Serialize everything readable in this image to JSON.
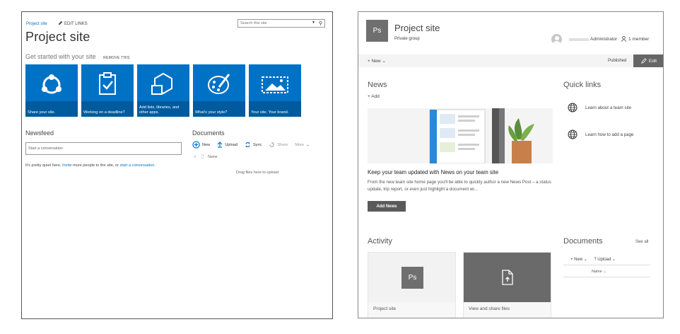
{
  "left": {
    "breadcrumb": "Project site",
    "edit_links": "EDIT LINKS",
    "search_placeholder": "Search this site",
    "title": "Project site",
    "get_started": "Get started with your site",
    "remove_this": "REMOVE THIS",
    "tiles": [
      {
        "label": "Share your site.",
        "icon": "share-icon"
      },
      {
        "label": "Working on a deadline?",
        "icon": "task-clipboard-icon"
      },
      {
        "label": "Add lists, libraries, and other apps.",
        "icon": "apps-hexagon-icon"
      },
      {
        "label": "What's your style?",
        "icon": "palette-icon"
      },
      {
        "label": "Your site. Your brand.",
        "icon": "picture-icon"
      }
    ],
    "newsfeed": "Newsfeed",
    "conversation_placeholder": "Start a conversation",
    "quiet_pre": "It's pretty quiet here. ",
    "quiet_invite": "Invite",
    "quiet_mid": " more people to the site, or ",
    "quiet_start": "start a conversation.",
    "documents": "Documents",
    "toolbar": {
      "new": "New",
      "upload": "Upload",
      "sync": "Sync",
      "share": "Share",
      "more": "More"
    },
    "name_column": "Name",
    "drag_hint": "Drag files here to upload",
    "accent": "#0072c6"
  },
  "right": {
    "logo_initials": "Ps",
    "title": "Project site",
    "subtitle": "Private group",
    "user_name": "Administrator",
    "members": "1 member",
    "new": "New",
    "published": "Published",
    "edit": "Edit",
    "news_heading": "News",
    "add": "Add",
    "headline": "Keep your team updated with News on your team site",
    "body": "From the new team site home page you'll be able to quickly author a new News Post – a status update, trip report, or even just highlight a document wi...",
    "add_news": "Add News",
    "quick_links_heading": "Quick links",
    "quick_links": [
      "Learn about a team site",
      "Learn how to add a page"
    ],
    "activity_heading": "Activity",
    "activity_cards": [
      "Project site",
      "View and share files"
    ],
    "documents_heading": "Documents",
    "see_all": "See all",
    "doc_new": "New",
    "doc_upload": "Upload",
    "doc_name": "Name"
  }
}
